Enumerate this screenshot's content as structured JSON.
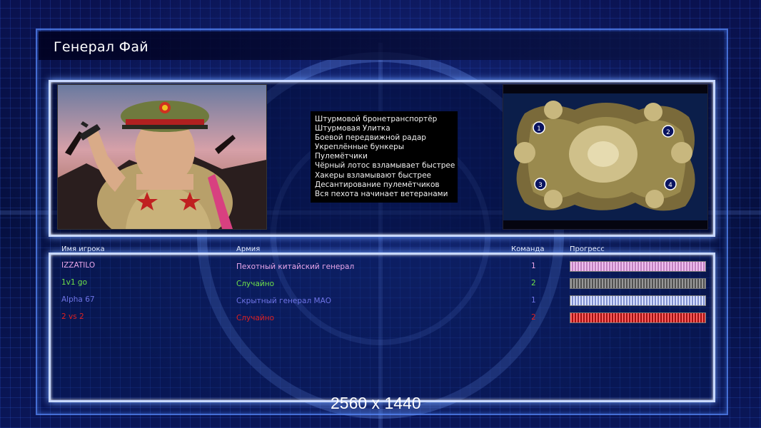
{
  "title": "Генерал Фай",
  "general_bonuses": [
    "Штурмовой бронетранспортёр",
    "Штурмовая Улитка",
    "Боевой передвижной радар",
    "Укреплённые бункеры",
    "Пулемётчики",
    "Чёрный лотос взламывает быстрее",
    "Хакеры взламывают быстрее",
    "Десантирование пулемётчиков",
    "Вся пехота начинает ветеранами"
  ],
  "map": {
    "start_positions": [
      "1",
      "2",
      "3",
      "4"
    ]
  },
  "table": {
    "headers": {
      "player": "Имя игрока",
      "army": "Армия",
      "team": "Команда",
      "progress": "Прогресс"
    },
    "rows": [
      {
        "player": "IZZATILO",
        "army": "Пехотный китайский генерал",
        "team": "1",
        "color": "#e9a6e9",
        "bar_color": "#d9a0d9",
        "progress": 1.0
      },
      {
        "player": "1v1 go",
        "army": "Случайно",
        "team": "2",
        "color": "#6fe04a",
        "bar_color": "#8a8a8a",
        "progress": 1.0
      },
      {
        "player": "Alpha 67",
        "army": "Скрытный генерал МАО",
        "team": "1",
        "color": "#6f74e6",
        "bar_color": "#b5c3f0",
        "progress": 1.0
      },
      {
        "player": "2 vs 2",
        "army": "Случайно",
        "team": "2",
        "color": "#e02020",
        "bar_color": "#e03030",
        "progress": 1.0
      }
    ]
  },
  "resolution_label": "2560 x 1440"
}
